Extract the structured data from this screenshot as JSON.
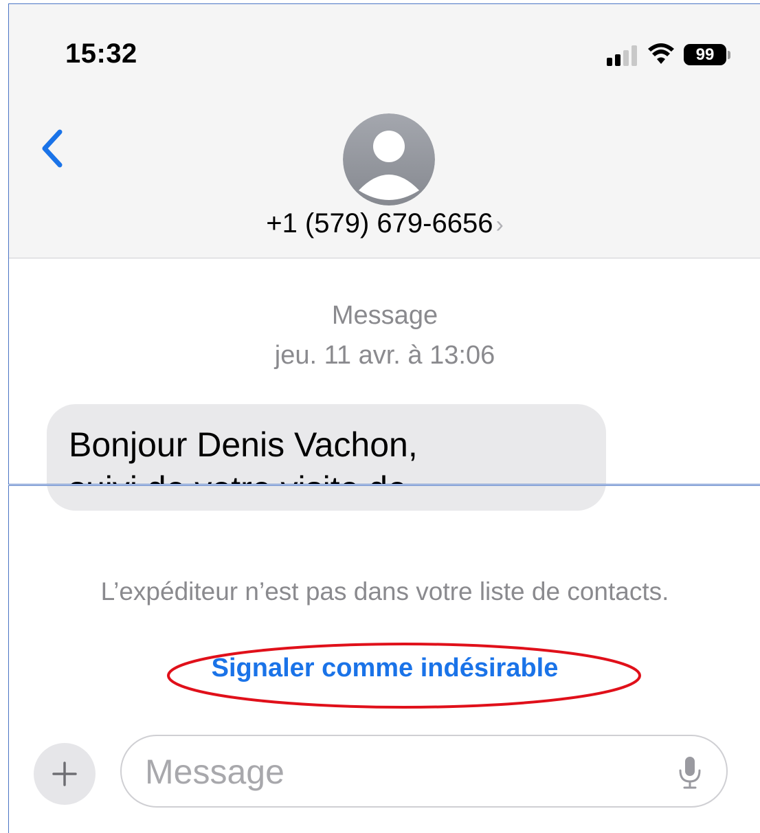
{
  "status_bar": {
    "time": "15:32",
    "battery_level": "99",
    "signal_bars": 2,
    "icons": [
      "signal-icon",
      "wifi-icon",
      "battery-icon"
    ]
  },
  "header": {
    "back_icon": "chevron-left-icon",
    "contact_number": "+1 (579) 679-6656",
    "contact_chevron": "›",
    "avatar_icon": "person-placeholder-icon"
  },
  "thread": {
    "label": "Message",
    "date_day": "jeu. 11 avr.",
    "date_sep": " à ",
    "date_time": "13:06",
    "bubble_line_1": "Bonjour Denis Vachon,",
    "bubble_line_2": "suivi de votre visite de"
  },
  "notice": {
    "unknown_sender": "L’expéditeur n’est pas dans votre liste de contacts.",
    "report_junk": "Signaler comme indésirable"
  },
  "composer": {
    "placeholder": "Message",
    "plus_icon": "plus-icon",
    "mic_icon": "microphone-icon"
  },
  "colors": {
    "accent": "#1a73e8",
    "highlight_annotation": "#e0101a",
    "bubble": "#e9e9eb",
    "header_bg": "#f5f5f5",
    "panel_border": "#4a74c4"
  }
}
